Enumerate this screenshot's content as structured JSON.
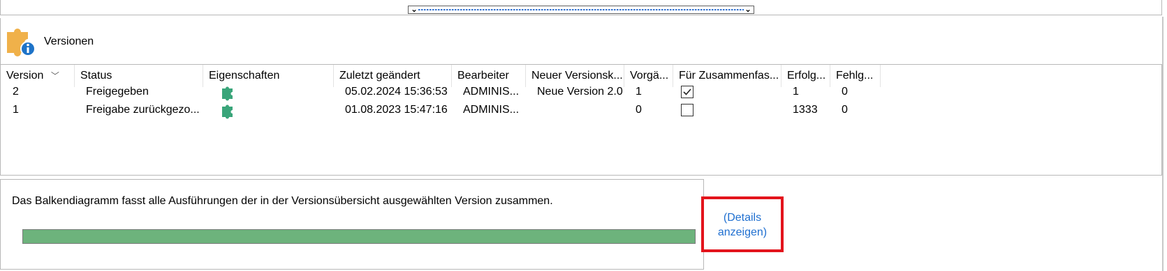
{
  "section": {
    "title": "Versionen"
  },
  "table": {
    "columns": [
      {
        "label": "Version",
        "sorted": true
      },
      {
        "label": "Status"
      },
      {
        "label": "Eigenschaften"
      },
      {
        "label": "Zuletzt geändert"
      },
      {
        "label": "Bearbeiter"
      },
      {
        "label": "Neuer Versionsk..."
      },
      {
        "label": "Vorgä..."
      },
      {
        "label": "Für Zusammenfas..."
      },
      {
        "label": "Erfolg..."
      },
      {
        "label": "Fehlg..."
      }
    ],
    "rows": [
      {
        "version": "2",
        "status": "Freigegeben",
        "properties_icon": "puzzle-icon",
        "changed": "05.02.2024 15:36:53",
        "editor": "ADMINIS...",
        "new_version": "Neue Version 2.0",
        "predecessor": "1",
        "summary_checked": true,
        "success": "1",
        "failed": "0"
      },
      {
        "version": "1",
        "status": "Freigabe zurückgezo...",
        "properties_icon": "puzzle-icon",
        "changed": "01.08.2023 15:47:16",
        "editor": "ADMINIS...",
        "new_version": "",
        "predecessor": "0",
        "summary_checked": false,
        "success": "1333",
        "failed": "0"
      }
    ]
  },
  "chart": {
    "description": "Das Balkendiagramm fasst alle Ausführungen der in der Versionsübersicht ausgewählten Version zusammen.",
    "success_fraction": 1.0,
    "bar_color": "#6db37c"
  },
  "details_link": {
    "line1": "(Details",
    "line2": "anzeigen)"
  },
  "colors": {
    "highlight": "#e3141c",
    "link": "#1f6fd0",
    "icon_green": "#3aa57a",
    "icon_orange": "#f0b14a",
    "icon_blue": "#1e73c8"
  }
}
